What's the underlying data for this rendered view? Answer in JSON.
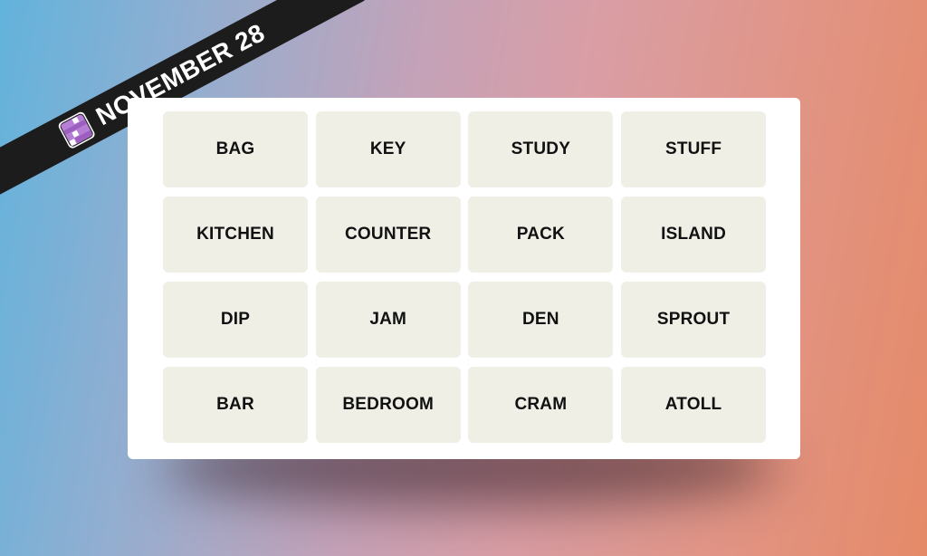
{
  "banner": {
    "date": "NOVEMBER 28",
    "icon": "connections-grid-icon",
    "icon_color": "#b77ed6"
  },
  "tiles": [
    "BAG",
    "KEY",
    "STUDY",
    "STUFF",
    "KITCHEN",
    "COUNTER",
    "PACK",
    "ISLAND",
    "DIP",
    "JAM",
    "DEN",
    "SPROUT",
    "BAR",
    "BEDROOM",
    "CRAM",
    "ATOLL"
  ],
  "colors": {
    "tile_bg": "#efefe6",
    "card_bg": "#ffffff"
  }
}
